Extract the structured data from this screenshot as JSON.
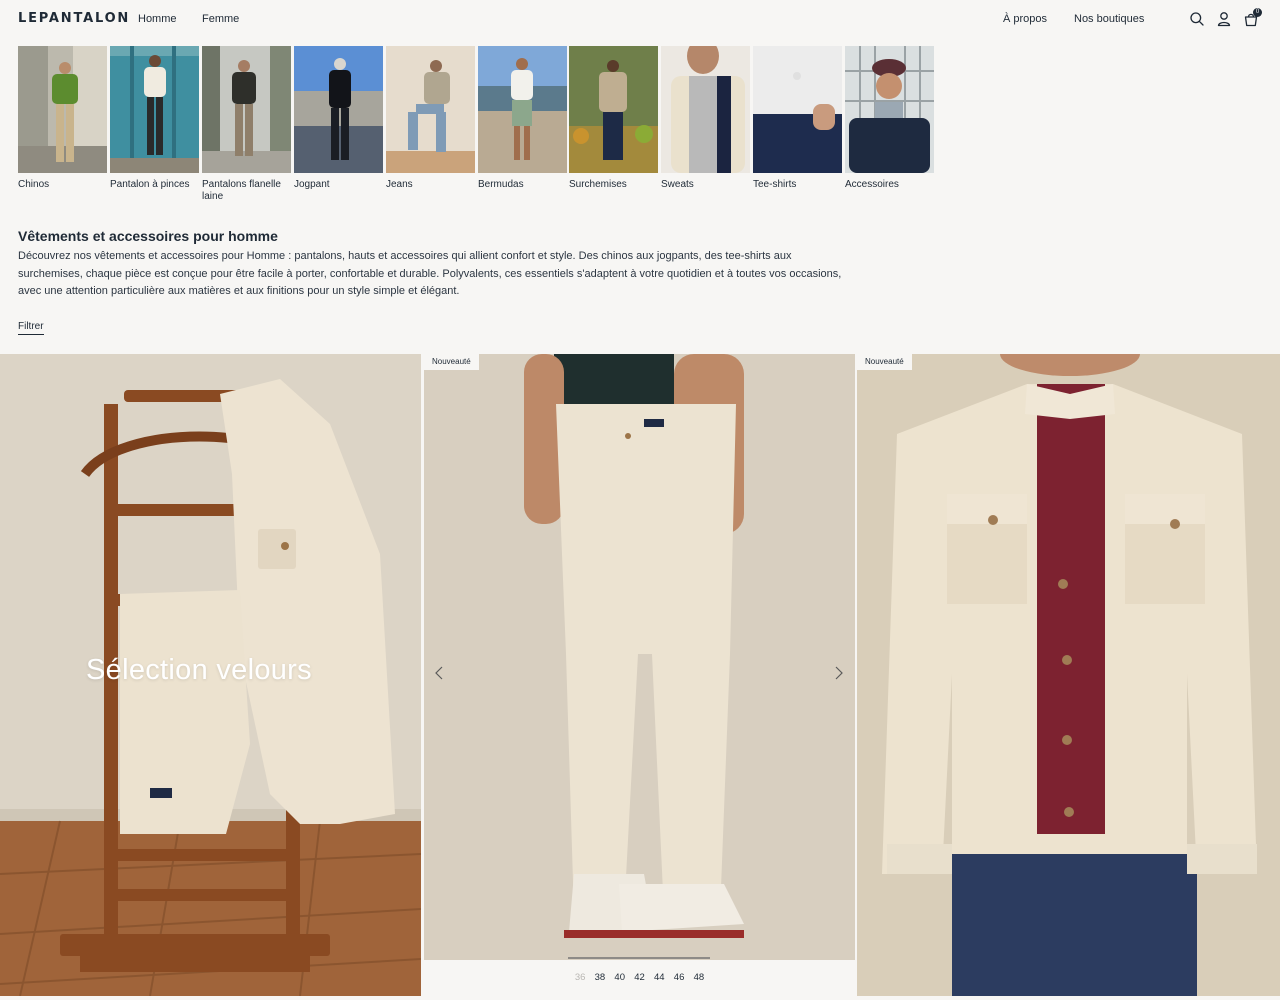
{
  "header": {
    "logo": "LEPANTALON",
    "nav": [
      "Homme",
      "Femme"
    ],
    "right_links": [
      "À propos",
      "Nos boutiques"
    ],
    "cart_count": "0",
    "icons": [
      "search-icon",
      "account-icon",
      "cart-icon"
    ]
  },
  "categories": [
    {
      "label": "Chinos"
    },
    {
      "label": "Pantalon à pinces"
    },
    {
      "label": "Pantalons flanelle laine"
    },
    {
      "label": "Jogpant"
    },
    {
      "label": "Jeans"
    },
    {
      "label": "Bermudas"
    },
    {
      "label": "Surchemises"
    },
    {
      "label": "Sweats"
    },
    {
      "label": "Tee-shirts"
    },
    {
      "label": "Accessoires"
    }
  ],
  "intro": {
    "title": "Vêtements et accessoires pour homme",
    "text": "Découvrez nos vêtements et accessoires pour Homme : pantalons, hauts et accessoires qui allient confort et style. Des chinos aux jogpants, des tee-shirts aux surchemises, chaque pièce est conçue pour être facile à porter, confortable et durable. Polyvalents, ces essentiels s'adaptent à votre quotidien et à toutes vos occasions, avec une attention particulière aux matières et aux finitions pour un style simple et élégant."
  },
  "filter_label": "Filtrer",
  "hero": {
    "title": "Sélection velours"
  },
  "products": [
    {
      "badge": "Nouveauté",
      "sizes": [
        {
          "label": "36",
          "available": false
        },
        {
          "label": "38",
          "available": true
        },
        {
          "label": "40",
          "available": true
        },
        {
          "label": "42",
          "available": true
        },
        {
          "label": "44",
          "available": true
        },
        {
          "label": "46",
          "available": true
        },
        {
          "label": "48",
          "available": true
        }
      ]
    },
    {
      "badge": "Nouveauté"
    }
  ]
}
